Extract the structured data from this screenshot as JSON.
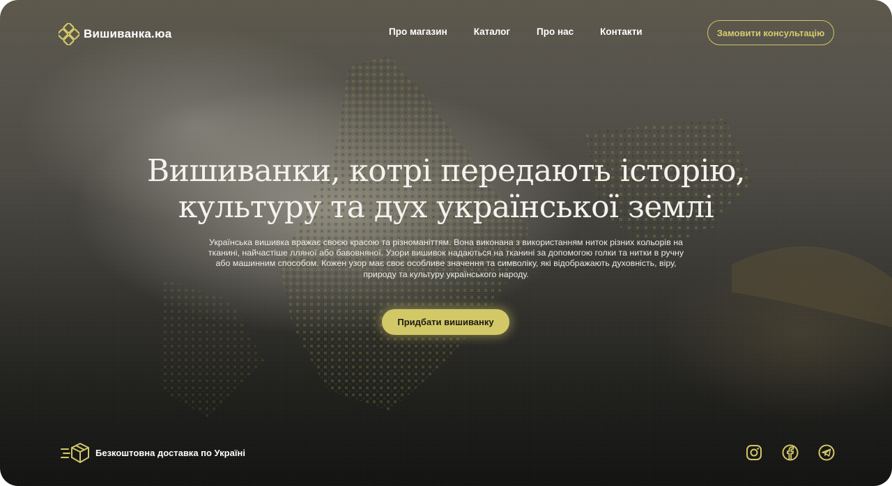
{
  "brand": {
    "name": "Вишиванка.юа",
    "logo_icon": "diamond-knot-icon",
    "accent_color": "#d3c867"
  },
  "nav": {
    "items": [
      {
        "label": "Про магазин"
      },
      {
        "label": "Каталог"
      },
      {
        "label": "Про нас"
      },
      {
        "label": "Контакти"
      }
    ],
    "consult_label": "Замовити консультацію"
  },
  "hero": {
    "title_line1": "Вишиванки, котрі передають історію,",
    "title_line2": "культуру та дух української землі",
    "description": "Українська вишивка вражає своєю красою та різноманіттям. Вона виконана з використанням ниток різних кольорів на тканині, найчастіше лляної або бавовняної. Узори вишивок надаються на тканині за допомогою голки та нитки в ручну або машинним способом. Кожен узор має своє особливе значення та символіку, які відображають духовність, віру, природу та культуру українського народу.",
    "cta_label": "Придбати вишиванку"
  },
  "footer": {
    "delivery_icon": "delivery-box-icon",
    "delivery_text": "Безкоштовна доставка по Україні",
    "socials": [
      "instagram-icon",
      "facebook-icon",
      "telegram-icon"
    ]
  }
}
